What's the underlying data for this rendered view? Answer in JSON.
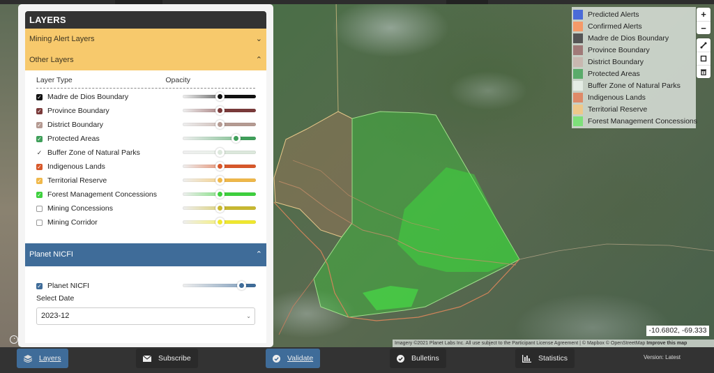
{
  "sidebar": {
    "title": "LAYERS",
    "sections": {
      "mining_alert": {
        "label": "Mining Alert Layers",
        "expanded": false
      },
      "other": {
        "label": "Other Layers",
        "expanded": true
      },
      "planet": {
        "label": "Planet NICFI",
        "expanded": true
      }
    },
    "columns": {
      "layer_type": "Layer Type",
      "opacity": "Opacity"
    },
    "layers": [
      {
        "label": "Madre de Dios Boundary",
        "checked": true,
        "color": "#111111",
        "opacity": 0.5
      },
      {
        "label": "Province Boundary",
        "checked": true,
        "color": "#7a3a3a",
        "opacity": 0.5
      },
      {
        "label": "District Boundary",
        "checked": true,
        "color": "#b59a92",
        "opacity": 0.5
      },
      {
        "label": "Protected Areas",
        "checked": true,
        "color": "#3f9f5a",
        "opacity": 0.72
      },
      {
        "label": "Buffer Zone of Natural Parks",
        "checked": true,
        "color": "#dce8dc",
        "opacity": 0.5
      },
      {
        "label": "Indigenous Lands",
        "checked": true,
        "color": "#d8582a",
        "opacity": 0.5
      },
      {
        "label": "Territorial Reserve",
        "checked": true,
        "color": "#f0b84a",
        "opacity": 0.5
      },
      {
        "label": "Forest Management Concessions",
        "checked": true,
        "color": "#3ed03e",
        "opacity": 0.5
      },
      {
        "label": "Mining Concessions",
        "checked": false,
        "color": "#c8b830",
        "opacity": 0.5
      },
      {
        "label": "Mining Corridor",
        "checked": false,
        "color": "#f0e830",
        "opacity": 0.5
      }
    ],
    "planet": {
      "label": "Planet NICFI",
      "checked": true,
      "color": "#3f6c99",
      "opacity": 0.8,
      "select_label": "Select Date",
      "select_value": "2023-12"
    }
  },
  "legend": [
    {
      "label": "Predicted Alerts",
      "color": "#4a6bd8"
    },
    {
      "label": "Confirmed Alerts",
      "color": "#f59a68"
    },
    {
      "label": "Madre de Dios Boundary",
      "color": "#555555"
    },
    {
      "label": "Province Boundary",
      "color": "#a07a78"
    },
    {
      "label": "District Boundary",
      "color": "#c8b8b0"
    },
    {
      "label": "Protected Areas",
      "color": "#5aab6a"
    },
    {
      "label": "Buffer Zone of Natural Parks",
      "color": "#e4ece4"
    },
    {
      "label": "Indigenous Lands",
      "color": "#de8a68"
    },
    {
      "label": "Territorial Reserve",
      "color": "#eec88a"
    },
    {
      "label": "Forest Management Concessions",
      "color": "#7ee07a"
    }
  ],
  "map": {
    "controls": {
      "zoom_in": "+",
      "zoom_out": "−",
      "draw_line": "⟋",
      "draw_polygon": "□",
      "trash": "🗑"
    },
    "coordinates": "-10.6802, -69.333",
    "attribution": "Imagery ©2021 Planet Labs Inc. All use subject to the Participant License Agreement | © Mapbox © OpenStreetMap",
    "improve_link": "Improve this map"
  },
  "bottom_nav": {
    "items": [
      {
        "label": "Layers",
        "icon": "layers-icon",
        "active": true
      },
      {
        "label": "Subscribe",
        "icon": "envelope-icon",
        "active": false
      },
      {
        "label": "Validate",
        "icon": "check-circle-icon",
        "active": true
      },
      {
        "label": "Bulletins",
        "icon": "check-circle-icon",
        "active": false
      },
      {
        "label": "Statistics",
        "icon": "bar-chart-icon",
        "active": false
      }
    ],
    "version": "Version: Latest"
  }
}
